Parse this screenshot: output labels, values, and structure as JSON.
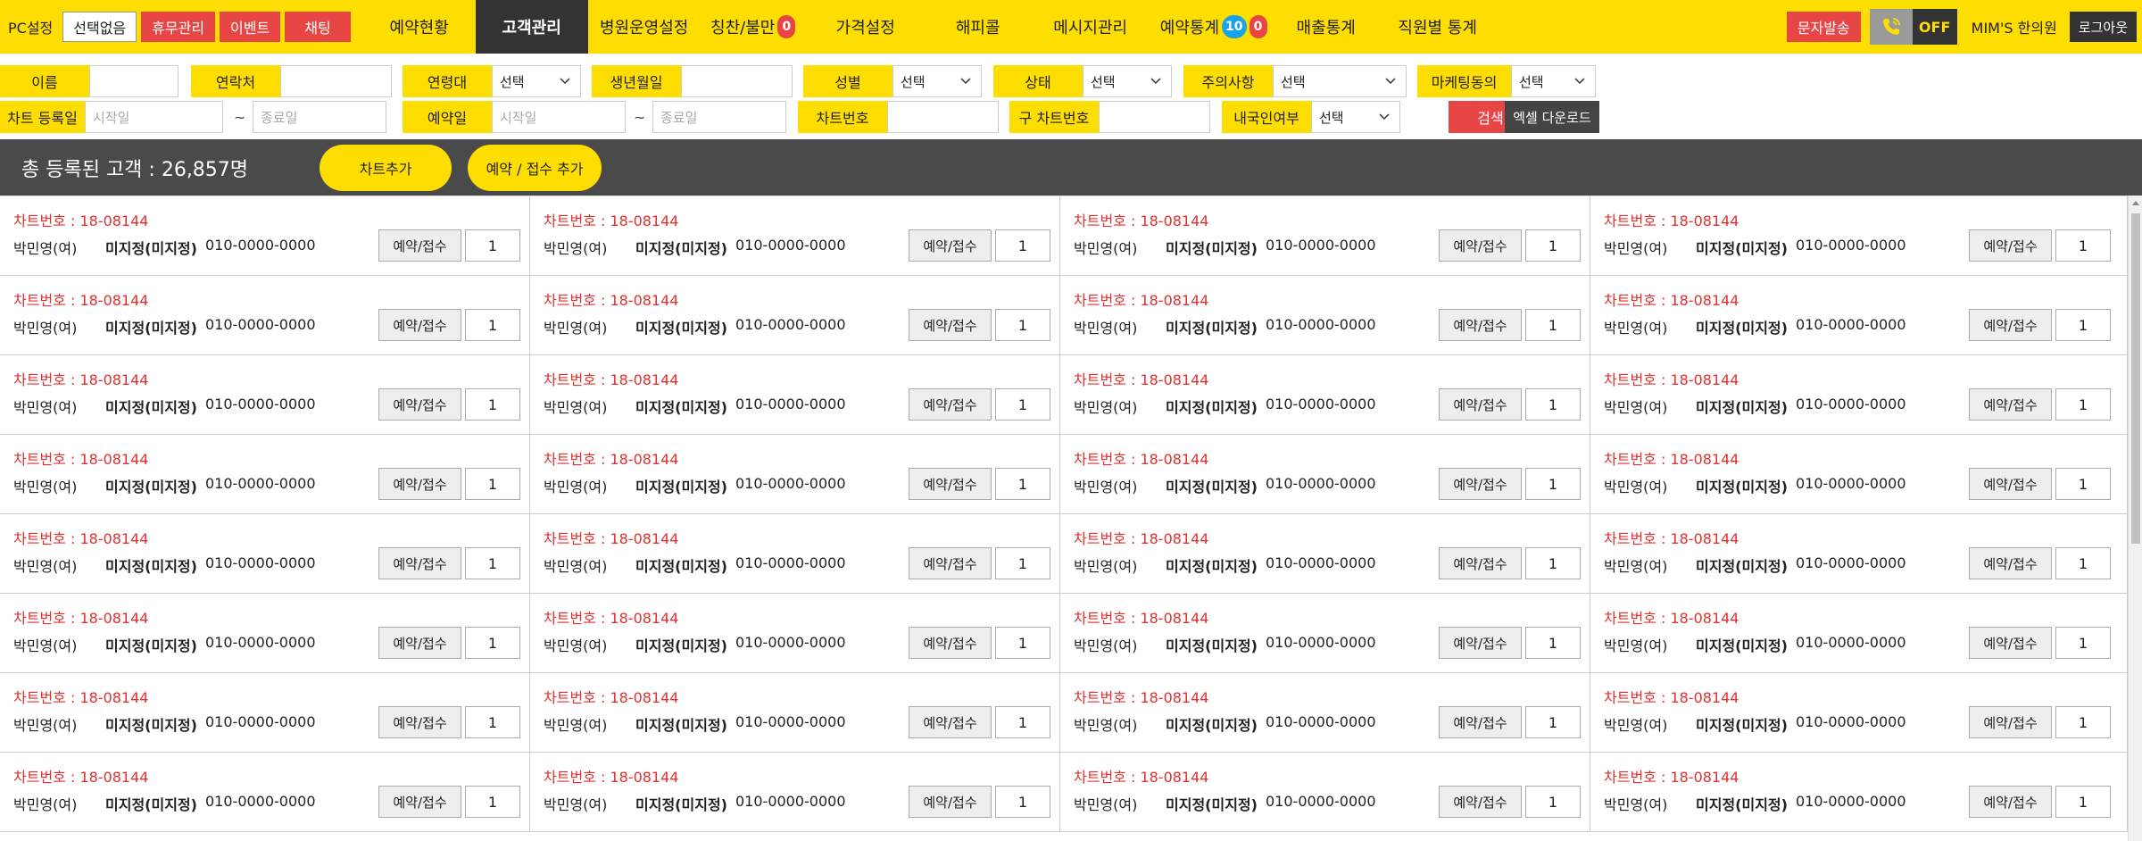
{
  "topbar": {
    "pc_label": "PC설정",
    "select_none": "선택없음",
    "holiday": "휴무관리",
    "event": "이벤트",
    "chat": "채팅",
    "nav": [
      {
        "label": "예약현황"
      },
      {
        "label": "고객관리",
        "active": true
      },
      {
        "label": "병원운영설정"
      },
      {
        "label": "칭찬/불만",
        "badge": "0",
        "badge_color": "#e84545"
      },
      {
        "label": "가격설정"
      },
      {
        "label": "해피콜"
      },
      {
        "label": "메시지관리"
      },
      {
        "label": "예약통계",
        "badge": "10",
        "badge_color": "#1aa3e8",
        "badge2": "0",
        "badge2_color": "#e84545"
      },
      {
        "label": "매출통계"
      },
      {
        "label": "직원별 통계"
      }
    ],
    "sms": "문자발송",
    "call_status": "OFF",
    "user": "MIM'S 한의원",
    "logout": "로그아웃"
  },
  "filters": {
    "name_label": "이름",
    "contact_label": "연락처",
    "age_label": "연령대",
    "age_value": "선택",
    "birth_label": "생년월일",
    "gender_label": "성별",
    "gender_value": "선택",
    "status_label": "상태",
    "status_value": "선택",
    "caution_label": "주의사항",
    "caution_value": "선택",
    "marketing_label": "마케팅동의",
    "marketing_value": "선택",
    "chart_reg_label": "차트 등록일",
    "start_placeholder": "시작일",
    "end_placeholder": "종료일",
    "tilde": "~",
    "reservation_label": "예약일",
    "chart_no_label": "차트번호",
    "old_chart_label": "구 차트번호",
    "domestic_label": "내국인여부",
    "domestic_value": "선택",
    "search": "검색",
    "excel": "엑셀 다운로드"
  },
  "summary": {
    "total_text": "총 등록된 고객 : 26,857명",
    "add_chart": "차트추가",
    "add_reservation": "예약 / 접수 추가"
  },
  "patients": [
    {
      "chart_no": "차트번호 : 18-08144",
      "name": "박민영(여)",
      "doctor": "미지정(미지정)",
      "phone": "010-0000-0000",
      "action": "예약/접수",
      "qty": "1"
    },
    {
      "chart_no": "차트번호 : 18-08144",
      "name": "박민영(여)",
      "doctor": "미지정(미지정)",
      "phone": "010-0000-0000",
      "action": "예약/접수",
      "qty": "1"
    },
    {
      "chart_no": "차트번호 : 18-08144",
      "name": "박민영(여)",
      "doctor": "미지정(미지정)",
      "phone": "010-0000-0000",
      "action": "예약/접수",
      "qty": "1"
    },
    {
      "chart_no": "차트번호 : 18-08144",
      "name": "박민영(여)",
      "doctor": "미지정(미지정)",
      "phone": "010-0000-0000",
      "action": "예약/접수",
      "qty": "1"
    },
    {
      "chart_no": "차트번호 : 18-08144",
      "name": "박민영(여)",
      "doctor": "미지정(미지정)",
      "phone": "010-0000-0000",
      "action": "예약/접수",
      "qty": "1"
    },
    {
      "chart_no": "차트번호 : 18-08144",
      "name": "박민영(여)",
      "doctor": "미지정(미지정)",
      "phone": "010-0000-0000",
      "action": "예약/접수",
      "qty": "1"
    },
    {
      "chart_no": "차트번호 : 18-08144",
      "name": "박민영(여)",
      "doctor": "미지정(미지정)",
      "phone": "010-0000-0000",
      "action": "예약/접수",
      "qty": "1"
    },
    {
      "chart_no": "차트번호 : 18-08144",
      "name": "박민영(여)",
      "doctor": "미지정(미지정)",
      "phone": "010-0000-0000",
      "action": "예약/접수",
      "qty": "1"
    },
    {
      "chart_no": "차트번호 : 18-08144",
      "name": "박민영(여)",
      "doctor": "미지정(미지정)",
      "phone": "010-0000-0000",
      "action": "예약/접수",
      "qty": "1"
    },
    {
      "chart_no": "차트번호 : 18-08144",
      "name": "박민영(여)",
      "doctor": "미지정(미지정)",
      "phone": "010-0000-0000",
      "action": "예약/접수",
      "qty": "1"
    },
    {
      "chart_no": "차트번호 : 18-08144",
      "name": "박민영(여)",
      "doctor": "미지정(미지정)",
      "phone": "010-0000-0000",
      "action": "예약/접수",
      "qty": "1"
    },
    {
      "chart_no": "차트번호 : 18-08144",
      "name": "박민영(여)",
      "doctor": "미지정(미지정)",
      "phone": "010-0000-0000",
      "action": "예약/접수",
      "qty": "1"
    },
    {
      "chart_no": "차트번호 : 18-08144",
      "name": "박민영(여)",
      "doctor": "미지정(미지정)",
      "phone": "010-0000-0000",
      "action": "예약/접수",
      "qty": "1"
    },
    {
      "chart_no": "차트번호 : 18-08144",
      "name": "박민영(여)",
      "doctor": "미지정(미지정)",
      "phone": "010-0000-0000",
      "action": "예약/접수",
      "qty": "1"
    },
    {
      "chart_no": "차트번호 : 18-08144",
      "name": "박민영(여)",
      "doctor": "미지정(미지정)",
      "phone": "010-0000-0000",
      "action": "예약/접수",
      "qty": "1"
    },
    {
      "chart_no": "차트번호 : 18-08144",
      "name": "박민영(여)",
      "doctor": "미지정(미지정)",
      "phone": "010-0000-0000",
      "action": "예약/접수",
      "qty": "1"
    },
    {
      "chart_no": "차트번호 : 18-08144",
      "name": "박민영(여)",
      "doctor": "미지정(미지정)",
      "phone": "010-0000-0000",
      "action": "예약/접수",
      "qty": "1"
    },
    {
      "chart_no": "차트번호 : 18-08144",
      "name": "박민영(여)",
      "doctor": "미지정(미지정)",
      "phone": "010-0000-0000",
      "action": "예약/접수",
      "qty": "1"
    },
    {
      "chart_no": "차트번호 : 18-08144",
      "name": "박민영(여)",
      "doctor": "미지정(미지정)",
      "phone": "010-0000-0000",
      "action": "예약/접수",
      "qty": "1"
    },
    {
      "chart_no": "차트번호 : 18-08144",
      "name": "박민영(여)",
      "doctor": "미지정(미지정)",
      "phone": "010-0000-0000",
      "action": "예약/접수",
      "qty": "1"
    },
    {
      "chart_no": "차트번호 : 18-08144",
      "name": "박민영(여)",
      "doctor": "미지정(미지정)",
      "phone": "010-0000-0000",
      "action": "예약/접수",
      "qty": "1"
    },
    {
      "chart_no": "차트번호 : 18-08144",
      "name": "박민영(여)",
      "doctor": "미지정(미지정)",
      "phone": "010-0000-0000",
      "action": "예약/접수",
      "qty": "1"
    },
    {
      "chart_no": "차트번호 : 18-08144",
      "name": "박민영(여)",
      "doctor": "미지정(미지정)",
      "phone": "010-0000-0000",
      "action": "예약/접수",
      "qty": "1"
    },
    {
      "chart_no": "차트번호 : 18-08144",
      "name": "박민영(여)",
      "doctor": "미지정(미지정)",
      "phone": "010-0000-0000",
      "action": "예약/접수",
      "qty": "1"
    },
    {
      "chart_no": "차트번호 : 18-08144",
      "name": "박민영(여)",
      "doctor": "미지정(미지정)",
      "phone": "010-0000-0000",
      "action": "예약/접수",
      "qty": "1"
    },
    {
      "chart_no": "차트번호 : 18-08144",
      "name": "박민영(여)",
      "doctor": "미지정(미지정)",
      "phone": "010-0000-0000",
      "action": "예약/접수",
      "qty": "1"
    },
    {
      "chart_no": "차트번호 : 18-08144",
      "name": "박민영(여)",
      "doctor": "미지정(미지정)",
      "phone": "010-0000-0000",
      "action": "예약/접수",
      "qty": "1"
    },
    {
      "chart_no": "차트번호 : 18-08144",
      "name": "박민영(여)",
      "doctor": "미지정(미지정)",
      "phone": "010-0000-0000",
      "action": "예약/접수",
      "qty": "1"
    },
    {
      "chart_no": "차트번호 : 18-08144",
      "name": "박민영(여)",
      "doctor": "미지정(미지정)",
      "phone": "010-0000-0000",
      "action": "예약/접수",
      "qty": "1"
    },
    {
      "chart_no": "차트번호 : 18-08144",
      "name": "박민영(여)",
      "doctor": "미지정(미지정)",
      "phone": "010-0000-0000",
      "action": "예약/접수",
      "qty": "1"
    },
    {
      "chart_no": "차트번호 : 18-08144",
      "name": "박민영(여)",
      "doctor": "미지정(미지정)",
      "phone": "010-0000-0000",
      "action": "예약/접수",
      "qty": "1"
    },
    {
      "chart_no": "차트번호 : 18-08144",
      "name": "박민영(여)",
      "doctor": "미지정(미지정)",
      "phone": "010-0000-0000",
      "action": "예약/접수",
      "qty": "1"
    }
  ],
  "colors": {
    "accent": "#fedd00",
    "danger": "#e84545",
    "dark": "#333333",
    "info": "#1aa3e8"
  }
}
